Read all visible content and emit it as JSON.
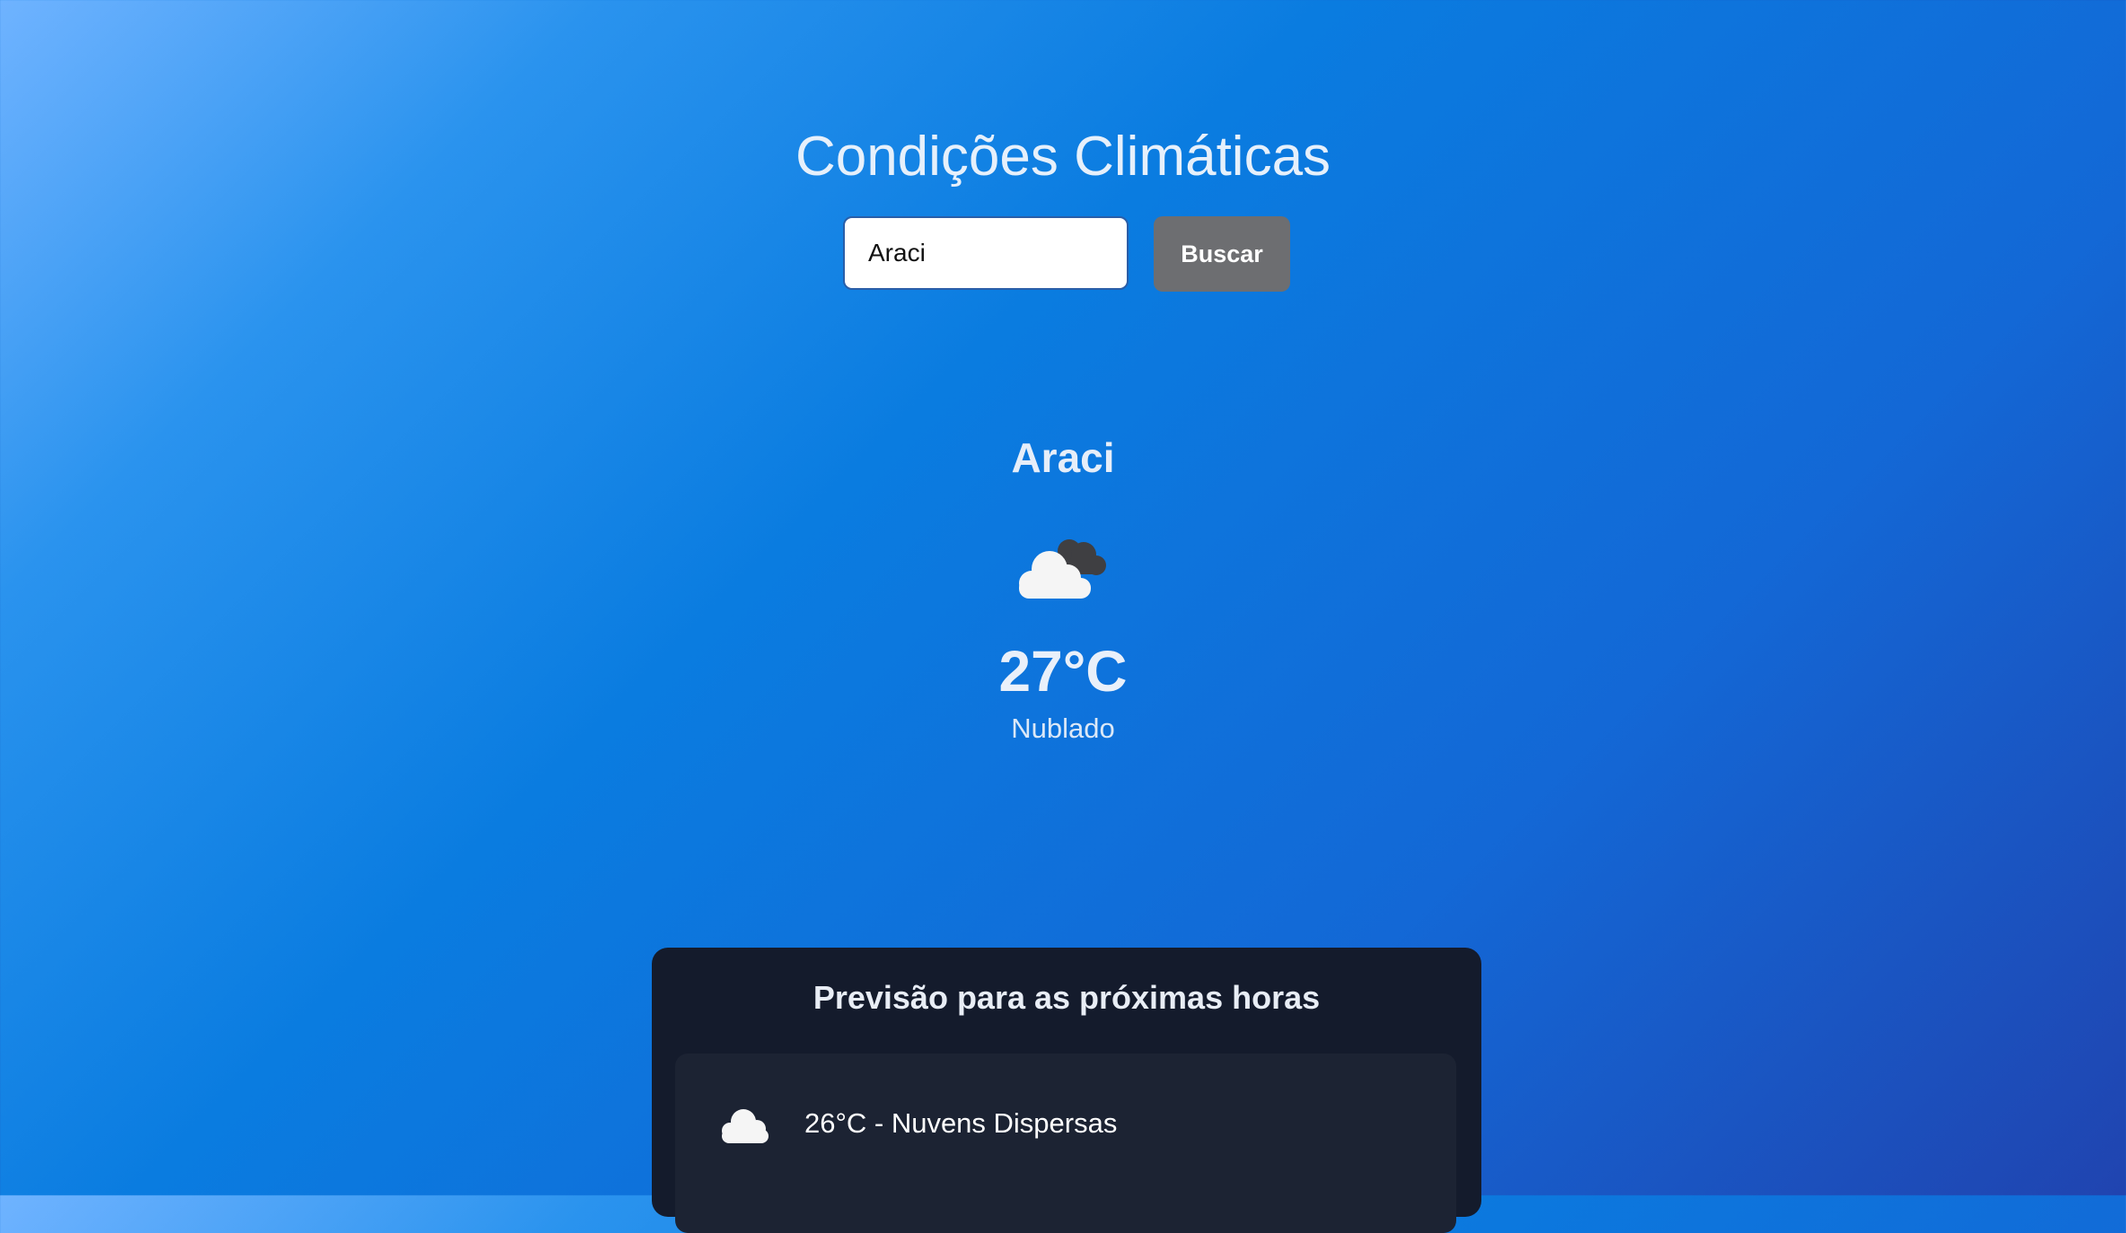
{
  "header": {
    "title": "Condições Climáticas"
  },
  "search": {
    "value": "Araci",
    "button_label": "Buscar"
  },
  "current": {
    "city": "Araci",
    "icon": "cloud-icon",
    "temperature": "27°C",
    "description": "Nublado"
  },
  "forecast": {
    "title": "Previsão para as próximas horas",
    "items": [
      {
        "icon": "cloud-icon",
        "text": "26°C - Nuvens Dispersas"
      }
    ]
  },
  "colors": {
    "background_gradient_start": "#6fb3ff",
    "background_gradient_end": "#2044b0",
    "panel_bg": "#141b2c",
    "item_bg": "#1c2333",
    "button_bg": "#6d6e71"
  }
}
